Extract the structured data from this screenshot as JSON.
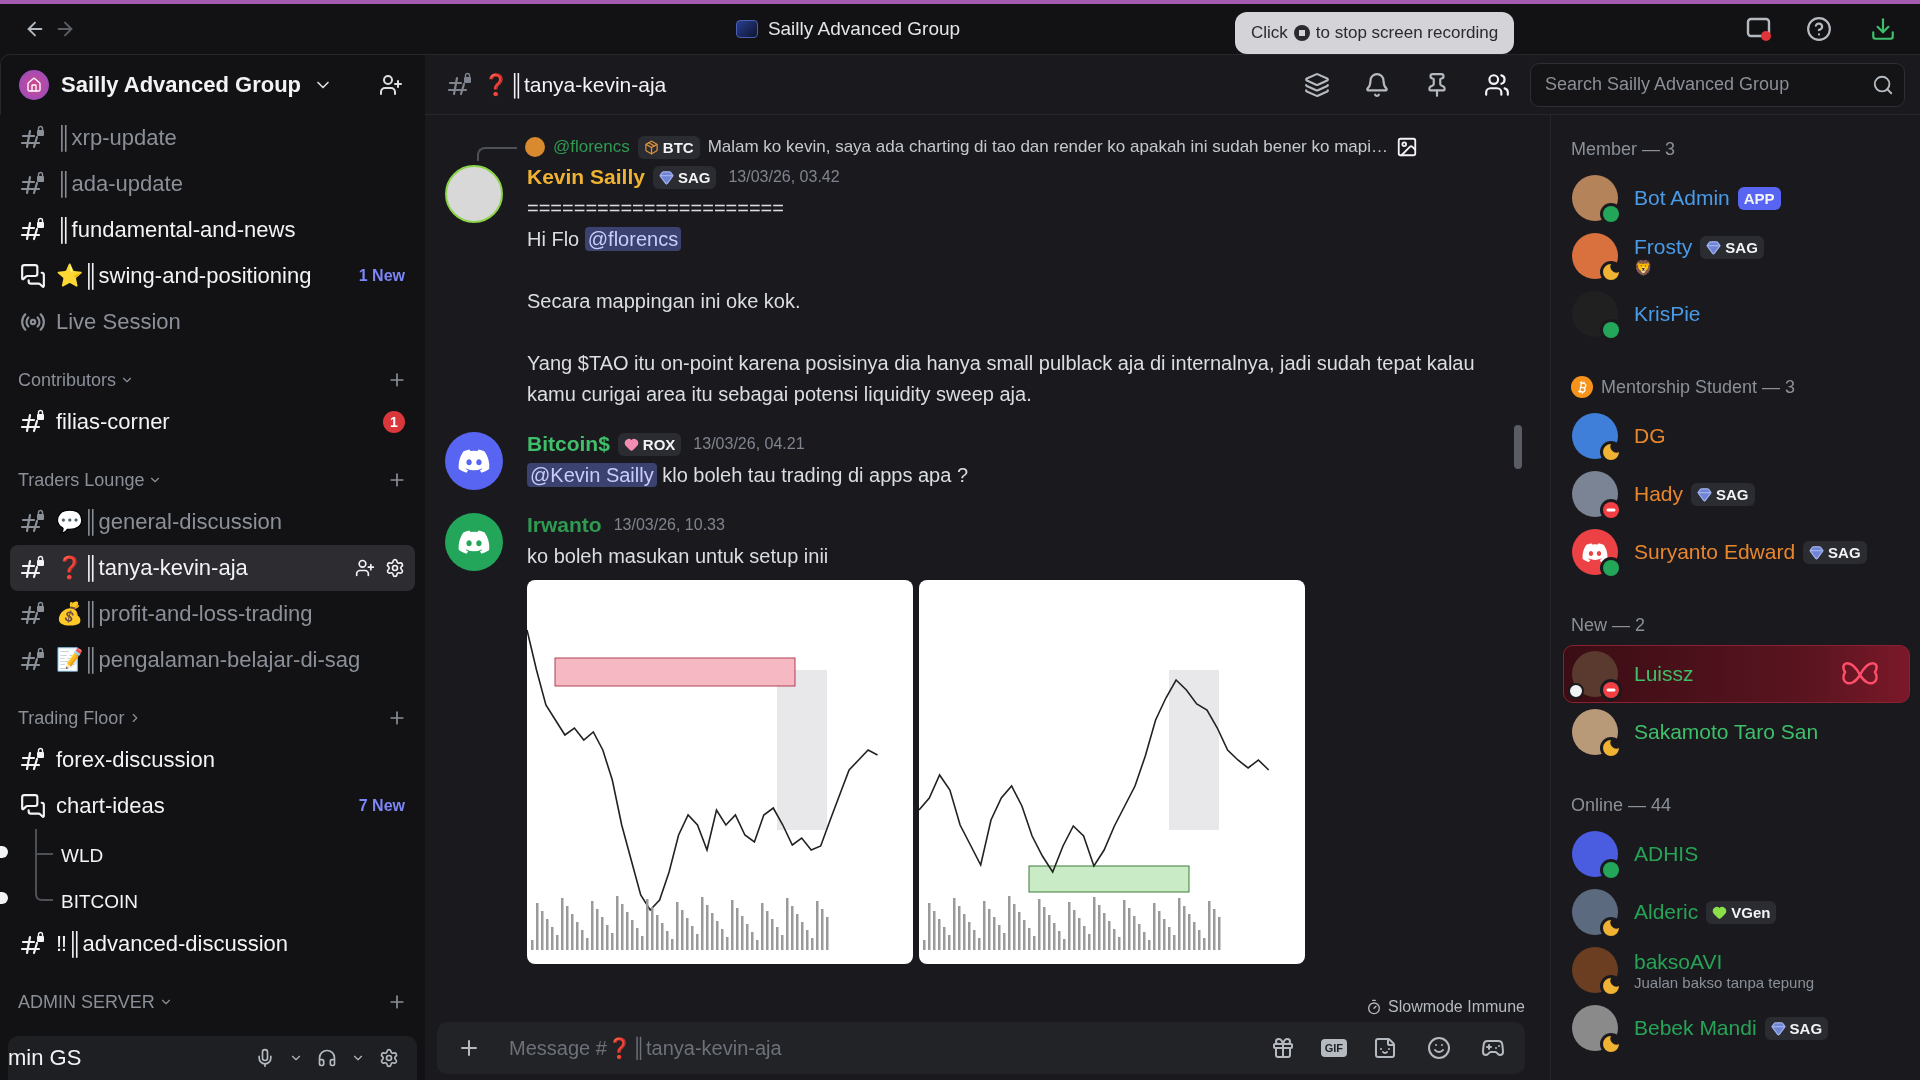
{
  "titlebar": {
    "title": "Sailly Advanced Group",
    "recording_hint": {
      "before": "Click",
      "after": "to stop screen recording"
    }
  },
  "server": {
    "name": "Sailly Advanced Group"
  },
  "sidebar": {
    "items": [
      {
        "kind": "text-channel",
        "name": "║xrp-update",
        "unread": false,
        "selected": false
      },
      {
        "kind": "text-channel",
        "name": "║ada-update",
        "unread": false,
        "selected": false
      },
      {
        "kind": "text-channel",
        "name": "║fundamental-and-news",
        "unread": true,
        "selected": false
      },
      {
        "kind": "forum-channel",
        "name": "⭐║swing-and-positioning",
        "unread": true,
        "selected": false,
        "badge": {
          "kind": "new",
          "text": "1 New"
        }
      },
      {
        "kind": "stage-channel",
        "name": "Live Session",
        "unread": false,
        "selected": false
      },
      {
        "kind": "category",
        "name": "Contributors",
        "expanded": true
      },
      {
        "kind": "text-channel",
        "name": "filias-corner",
        "unread": true,
        "selected": false,
        "badge": {
          "kind": "mention",
          "text": "1"
        }
      },
      {
        "kind": "category",
        "name": "Traders Lounge",
        "expanded": true
      },
      {
        "kind": "text-channel",
        "name": "💬║general-discussion",
        "unread": false,
        "selected": false
      },
      {
        "kind": "text-channel",
        "name": "❓║tanya-kevin-aja",
        "unread": true,
        "selected": true
      },
      {
        "kind": "text-channel",
        "name": "💰║profit-and-loss-trading",
        "unread": false,
        "selected": false
      },
      {
        "kind": "text-channel",
        "name": "📝║pengalaman-belajar-di-sag",
        "unread": false,
        "selected": false
      },
      {
        "kind": "category",
        "name": "Trading Floor",
        "expanded": false
      },
      {
        "kind": "text-channel",
        "name": "forex-discussion",
        "unread": true,
        "selected": false
      },
      {
        "kind": "forum-channel",
        "name": "chart-ideas",
        "unread": true,
        "selected": false,
        "badge": {
          "kind": "new",
          "text": "7 New"
        },
        "children": [
          {
            "name": "WLD",
            "unread": true,
            "selected": false
          },
          {
            "name": "BITCOIN",
            "unread": true,
            "selected": false
          }
        ]
      },
      {
        "kind": "text-channel",
        "name": "‼║advanced-discussion",
        "unread": true,
        "selected": false
      },
      {
        "kind": "category",
        "name": "ADMIN SERVER",
        "expanded": true
      }
    ],
    "user_panel": {
      "name": "min GS"
    }
  },
  "chat": {
    "channel": "❓║tanya-kevin-aja",
    "messages": [
      {
        "author": "Kevin Sailly",
        "color": "#f0b232",
        "avatar": {
          "kind": "photo",
          "color": "#d8d8d8"
        },
        "tag": {
          "kind": "gem",
          "label": "SAG"
        },
        "time": "13/03/26, 03.42",
        "reply": {
          "author": "@florencs",
          "tag": {
            "kind": "crate",
            "label": "BTC"
          },
          "text": "Malam ko kevin, saya ada charting di tao dan render ko apakah ini sudah bener ko mapi…"
        },
        "blocks": [
          {
            "lines": [
              {
                "parts": [
                  {
                    "kind": "text",
                    "text": "======================"
                  }
                ]
              },
              {
                "parts": [
                  {
                    "kind": "text",
                    "text": "Hi Flo"
                  },
                  {
                    "kind": "mention",
                    "text": "@florencs"
                  }
                ]
              }
            ]
          },
          {
            "lines": [
              {
                "parts": [
                  {
                    "kind": "text",
                    "text": "Secara mappingan ini oke kok."
                  }
                ]
              }
            ]
          },
          {
            "lines": [
              {
                "parts": [
                  {
                    "kind": "text",
                    "text": "Yang $TAO itu on-point karena posisinya dia hanya small pulblack aja di internalnya, jadi sudah tepat kalau kamu curigai area itu sebagai potensi liquidity sweep aja."
                  }
                ]
              }
            ]
          }
        ]
      },
      {
        "author": "Bitcoin$",
        "color": "#3fbf6a",
        "avatar": {
          "kind": "discord",
          "color": "#5865f2"
        },
        "tag": {
          "kind": "pink-heart",
          "label": "ROX"
        },
        "time": "13/03/26, 04.21",
        "blocks": [
          {
            "lines": [
              {
                "parts": [
                  {
                    "kind": "mention",
                    "text": "@Kevin Sailly"
                  },
                  {
                    "kind": "text",
                    "text": "klo boleh tau trading di apps apa ?"
                  }
                ]
              }
            ]
          }
        ]
      },
      {
        "author": "Irwanto",
        "color": "#2f9a52",
        "avatar": {
          "kind": "discord",
          "color": "#23a55a"
        },
        "time": "13/03/26, 10.33",
        "blocks": [
          {
            "lines": [
              {
                "parts": [
                  {
                    "kind": "text",
                    "text": "ko boleh masukan untuk setup inii"
                  }
                ]
              }
            ]
          }
        ],
        "attachments": [
          {
            "kind": "supply-chart"
          },
          {
            "kind": "demand-chart"
          }
        ]
      }
    ],
    "slowmode": "Slowmode Immune",
    "composer": {
      "placeholder": "Message #❓║tanya-kevin-aja",
      "gif_label": "GIF"
    }
  },
  "members": {
    "search_placeholder": "Search Sailly Advanced Group",
    "groups": [
      {
        "title": "Member — 3",
        "kind": "plain",
        "members": [
          {
            "name": "Bot Admin",
            "color": "#4a9be8",
            "avatar": {
              "kind": "photo",
              "color": "#b5835a"
            },
            "kind": "online",
            "tag": {
              "kind": "app",
              "label": "APP"
            }
          },
          {
            "name": "Frosty",
            "color": "#4a9be8",
            "avatar": {
              "kind": "photo",
              "color": "#d9713f"
            },
            "kind": "idle",
            "tag": {
              "kind": "gem",
              "label": "SAG"
            },
            "activity_emoji": "🦁"
          },
          {
            "name": "KrisPie",
            "color": "#4a9be8",
            "avatar": {
              "kind": "photo",
              "color": "#202020"
            },
            "kind": "online"
          }
        ]
      },
      {
        "title": "Mentorship Student — 3",
        "kind": "bitcoin",
        "members": [
          {
            "name": "DG",
            "color": "#e8862e",
            "avatar": {
              "kind": "photo",
              "color": "#3f7fd9"
            },
            "kind": "idle"
          },
          {
            "name": "Hady",
            "color": "#e8862e",
            "avatar": {
              "kind": "photo",
              "color": "#7a8494"
            },
            "kind": "dnd",
            "tag": {
              "kind": "gem",
              "label": "SAG"
            }
          },
          {
            "name": "Suryanto Edward",
            "color": "#e8862e",
            "avatar": {
              "kind": "discord",
              "color": "#ed4245"
            },
            "kind": "online",
            "tag": {
              "kind": "gem",
              "label": "SAG"
            }
          }
        ]
      },
      {
        "title": "New — 2",
        "kind": "plain",
        "members": [
          {
            "name": "Luissz",
            "color": "#3fbf6a",
            "avatar": {
              "kind": "photo",
              "color": "#5a3a2e"
            },
            "kind": "dnd",
            "nameplate": true,
            "flagged": true
          },
          {
            "name": "Sakamoto Taro San",
            "color": "#3fbf6a",
            "avatar": {
              "kind": "photo",
              "color": "#b89a78"
            },
            "kind": "idle"
          }
        ]
      },
      {
        "title": "Online — 44",
        "kind": "plain",
        "members": [
          {
            "name": "ADHIS",
            "color": "#27a357",
            "avatar": {
              "kind": "photo",
              "color": "#4a5de0"
            },
            "kind": "online"
          },
          {
            "name": "Alderic",
            "color": "#27a357",
            "avatar": {
              "kind": "photo",
              "color": "#5c6a80"
            },
            "kind": "idle",
            "tag": {
              "kind": "green-heart",
              "label": "VGen"
            }
          },
          {
            "name": "baksoAVI",
            "color": "#27a357",
            "avatar": {
              "kind": "photo",
              "color": "#6b3e22"
            },
            "kind": "idle",
            "subtitle": "Jualan bakso tanpa tepung"
          },
          {
            "name": "Bebek Mandi",
            "color": "#27a357",
            "avatar": {
              "kind": "photo",
              "color": "#8a8a8a"
            },
            "kind": "idle",
            "tag": {
              "kind": "gem",
              "label": "SAG"
            }
          }
        ]
      }
    ]
  }
}
